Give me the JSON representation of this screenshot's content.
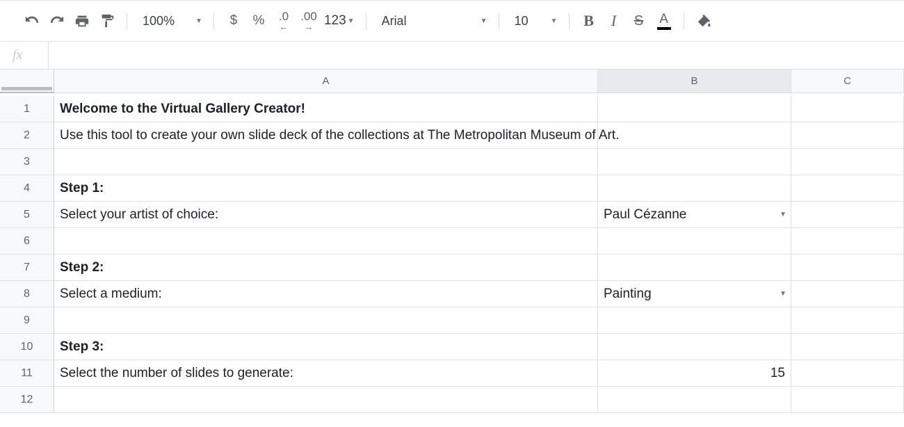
{
  "toolbar": {
    "zoom": "100%",
    "currency": "$",
    "percent": "%",
    "dec_minus": ".0",
    "dec_plus": ".00",
    "more_formats": "123",
    "font_name": "Arial",
    "font_size": "10",
    "bold": "B",
    "italic": "I",
    "strike": "S",
    "text_color": "A"
  },
  "formula_bar": {
    "fx_label": "fx",
    "value": ""
  },
  "columns": [
    "A",
    "B",
    "C"
  ],
  "rows": [
    "1",
    "2",
    "3",
    "4",
    "5",
    "6",
    "7",
    "8",
    "9",
    "10",
    "11",
    "12"
  ],
  "cells": {
    "A1": "Welcome to the Virtual Gallery Creator!",
    "A2": "Use this tool to create your own slide deck of the collections at The Metropolitan Museum of Art.",
    "A4": "Step 1:",
    "A5": "Select your artist of choice:",
    "B5": "Paul Cézanne",
    "A7": "Step 2:",
    "A8": "Select a medium:",
    "B8": "Painting",
    "A10": "Step 3:",
    "A11": "Select the number of slides to generate:",
    "B11": "15"
  },
  "selected_column": "B"
}
